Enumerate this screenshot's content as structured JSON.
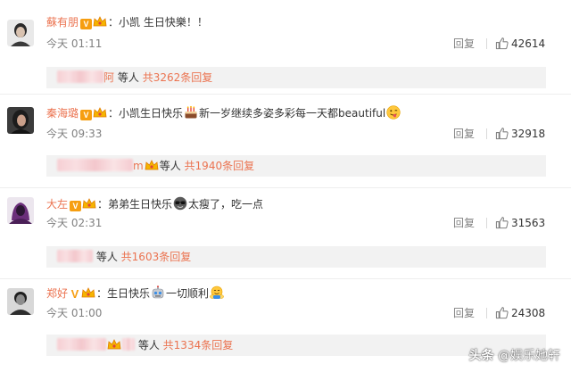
{
  "comments": [
    {
      "username": "蘇有朋",
      "verified": "V",
      "text": "：小凯 生日快樂！！",
      "time": "今天 01:11",
      "reply_label": "回复",
      "likes": "42614",
      "reply_tail": "阿",
      "reply_etc": "等人",
      "reply_count": "共3262条回复"
    },
    {
      "username": "秦海璐",
      "verified": "V",
      "text_a": "：小凯生日快乐",
      "text_b": "新一岁继续多姿多彩每一天都beautiful",
      "time": "今天 09:33",
      "reply_label": "回复",
      "likes": "32918",
      "reply_tail": "m",
      "reply_etc": "等人",
      "reply_count": "共1940条回复"
    },
    {
      "username": "大左",
      "verified": "V",
      "text_a": "：弟弟生日快乐",
      "text_b": "太瘦了，吃一点",
      "time": "今天 02:31",
      "reply_label": "回复",
      "likes": "31563",
      "reply_etc": "等人",
      "reply_count": "共1603条回复"
    },
    {
      "username": "郑好",
      "verified": "V",
      "text_a": "：生日快乐",
      "text_b": "一切顺利",
      "time": "今天 01:00",
      "reply_label": "回复",
      "likes": "24308",
      "reply_etc": "等人",
      "reply_count": "共1334条回复"
    }
  ],
  "watermark": {
    "prefix": "头条",
    "handle": "@娱乐她轩"
  },
  "colors": {
    "username": "#eb7350",
    "vbadge": "#f69e11",
    "meta": "#808080",
    "reply_box": "#f2f2f2"
  },
  "icons": [
    "crown-icon",
    "cake-icon",
    "tongue-face-icon",
    "glasses-icon",
    "robot-face-icon",
    "hugging-face-icon",
    "thumbs-up-icon"
  ]
}
